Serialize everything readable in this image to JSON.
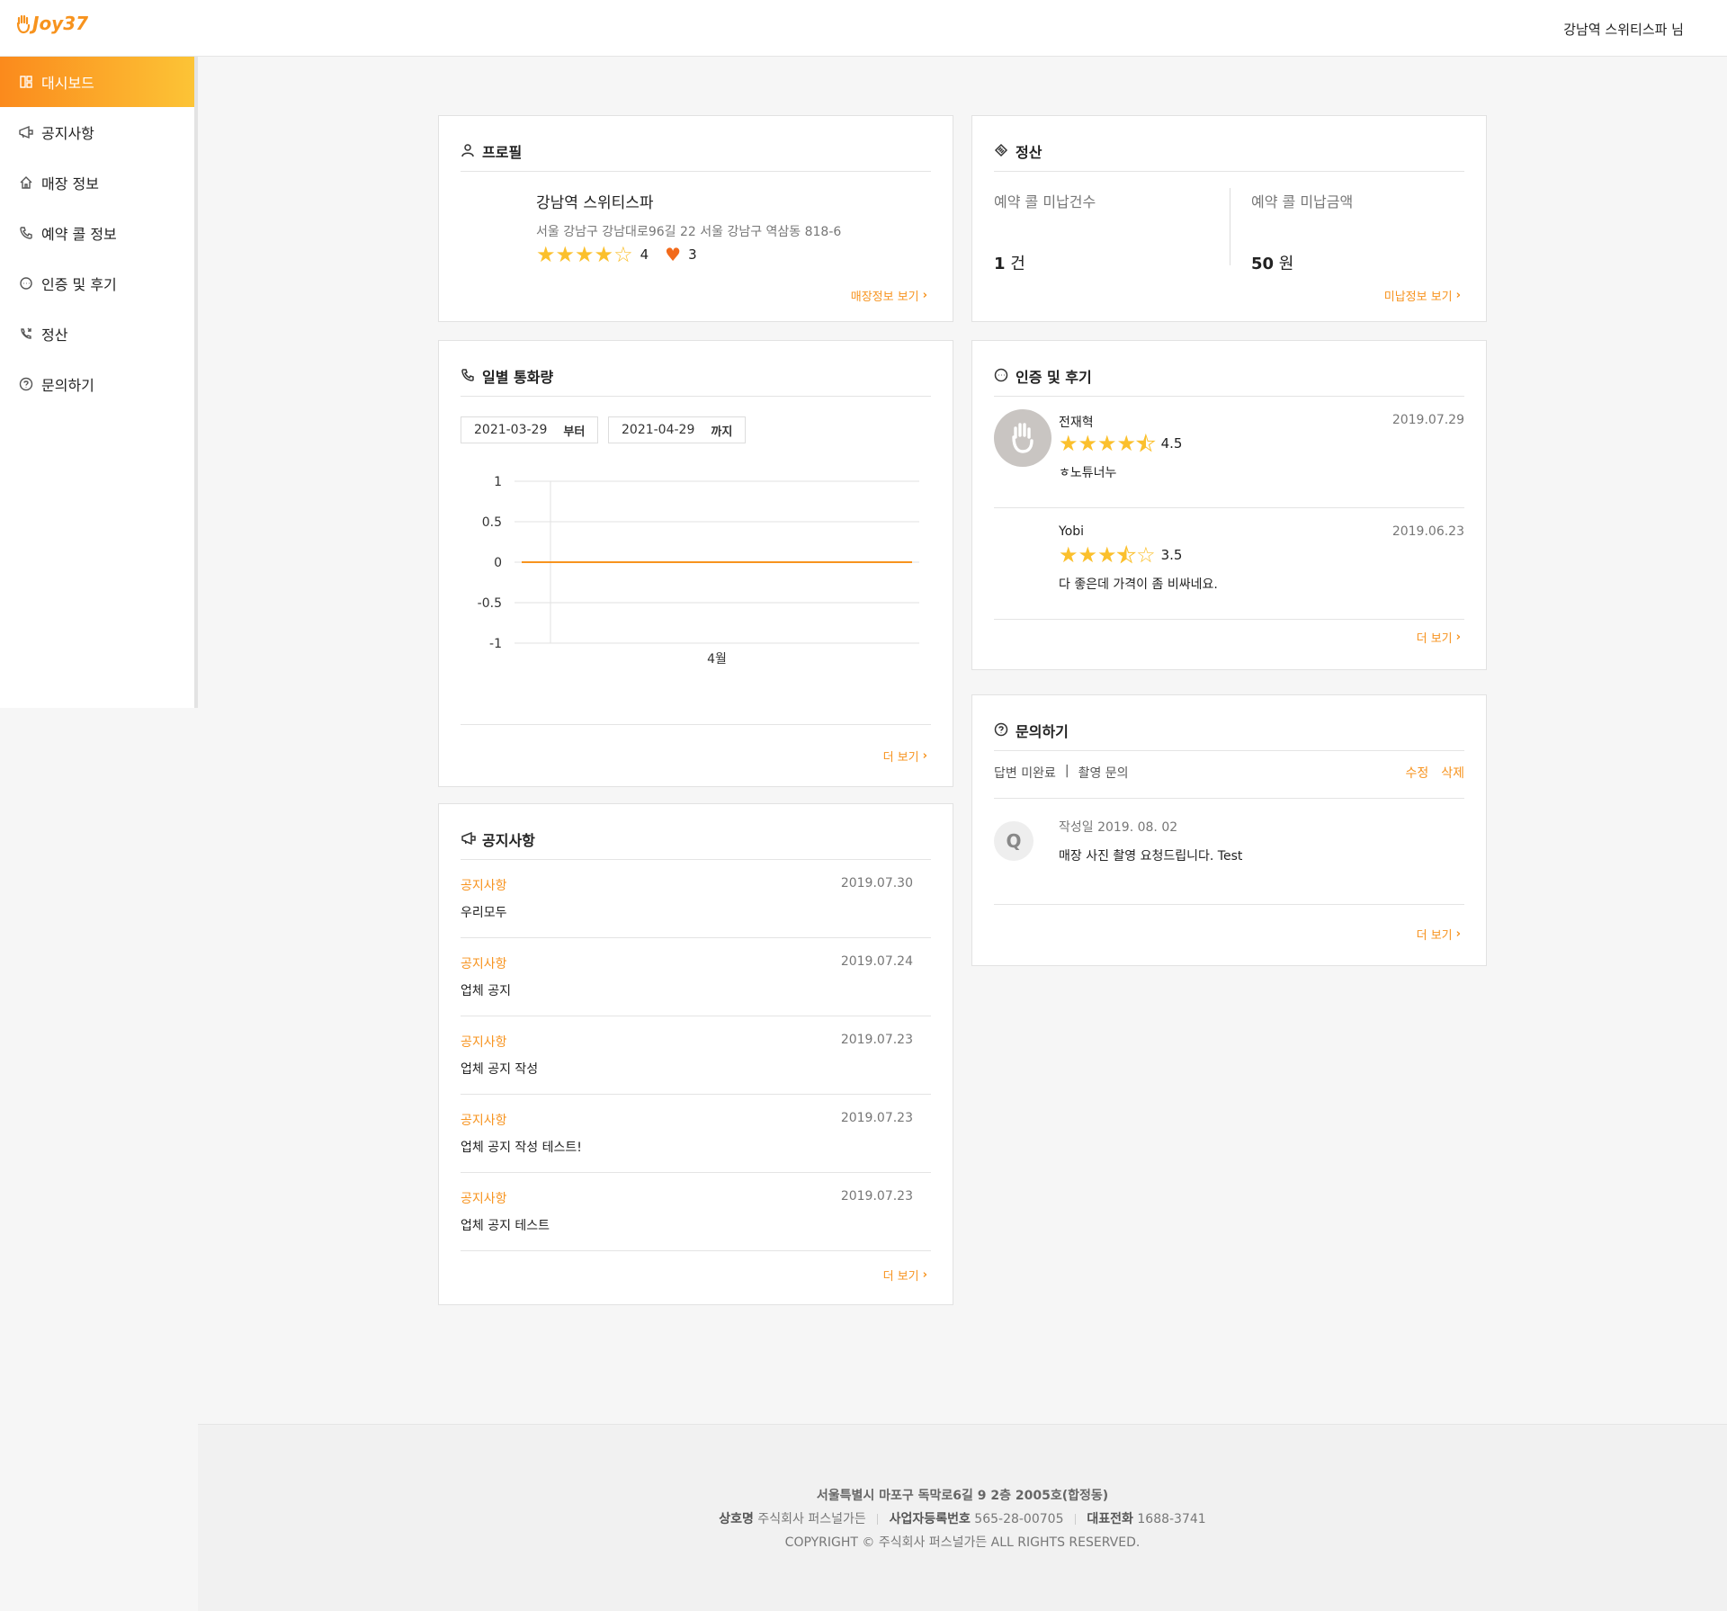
{
  "header": {
    "logo_text": "Joy37",
    "user_name": "강남역 스위티스파 님"
  },
  "sidebar": {
    "items": [
      {
        "label": "대시보드",
        "icon": "dashboard-icon",
        "active": true
      },
      {
        "label": "공지사항",
        "icon": "megaphone-icon"
      },
      {
        "label": "매장 정보",
        "icon": "home-icon"
      },
      {
        "label": "예약 콜 정보",
        "icon": "phone-icon"
      },
      {
        "label": "인증 및 후기",
        "icon": "chat-icon"
      },
      {
        "label": "정산",
        "icon": "phone-transfer-icon"
      },
      {
        "label": "문의하기",
        "icon": "question-icon"
      }
    ]
  },
  "profile": {
    "title": "프로필",
    "name": "강남역 스위티스파",
    "address": "서울 강남구 강남대로96길 22 서울 강남구 역삼동 818-6",
    "rating": "4",
    "rating_value": 4,
    "likes": "3",
    "link": "매장정보 보기"
  },
  "settlement": {
    "title": "정산",
    "count_label": "예약 콜 미납건수",
    "count_value": "1",
    "count_unit": "건",
    "amount_label": "예약 콜 미납금액",
    "amount_value": "50",
    "amount_unit": "원",
    "link": "미납정보 보기"
  },
  "daily_calls": {
    "title": "일별 통화량",
    "from_date": "2021-03-29",
    "from_suffix": "부터",
    "to_date": "2021-04-29",
    "to_suffix": "까지",
    "link": "더 보기"
  },
  "chart_data": {
    "type": "line",
    "categories": [
      "4월"
    ],
    "series": [
      {
        "values": [
          0,
          0
        ]
      }
    ],
    "yticks": [
      "1",
      "0.5",
      "0",
      "-0.5",
      "-1"
    ],
    "ylim": [
      -1,
      1
    ],
    "line_color": "#f7931e",
    "grid": true
  },
  "reviews": {
    "title": "인증 및 후기",
    "items": [
      {
        "name": "전재혁",
        "date": "2019.07.29",
        "rating": "4.5",
        "stars": 4.5,
        "text": "ㅎ노튜너누",
        "has_avatar": true
      },
      {
        "name": "Yobi",
        "date": "2019.06.23",
        "rating": "3.5",
        "stars": 3.5,
        "text": "다 좋은데 가격이 좀 비싸네요.",
        "has_avatar": false
      }
    ],
    "link": "더 보기"
  },
  "inquiry": {
    "title": "문의하기",
    "status": "답변 미완료",
    "separator": "|",
    "category": "촬영 문의",
    "edit": "수정",
    "delete": "삭제",
    "q_badge": "Q",
    "date": "작성일 2019. 08. 02",
    "text": "매장 사진 촬영 요청드립니다. Test",
    "link": "더 보기"
  },
  "notices": {
    "title": "공지사항",
    "items": [
      {
        "category": "공지사항",
        "date": "2019.07.30",
        "title": "우리모두"
      },
      {
        "category": "공지사항",
        "date": "2019.07.24",
        "title": "업체 공지"
      },
      {
        "category": "공지사항",
        "date": "2019.07.23",
        "title": "업체 공지 작성"
      },
      {
        "category": "공지사항",
        "date": "2019.07.23",
        "title": "업체 공지 작성 테스트!"
      },
      {
        "category": "공지사항",
        "date": "2019.07.23",
        "title": "업체 공지 테스트"
      }
    ],
    "link": "더 보기"
  },
  "footer": {
    "address": "서울특별시 마포구 독막로6길 9 2층 2005호(합정동)",
    "company_label": "상호명",
    "company": "주식회사 퍼스널가든",
    "reg_label": "사업자등록번호",
    "reg_no": "565-28-00705",
    "phone_label": "대표전화",
    "phone": "1688-3741",
    "copyright": "COPYRIGHT © 주식회사 퍼스널가든 ALL RIGHTS RESERVED."
  },
  "colors": {
    "accent": "#f7931e",
    "star": "#fbc02d",
    "heart": "#f26a1b"
  }
}
